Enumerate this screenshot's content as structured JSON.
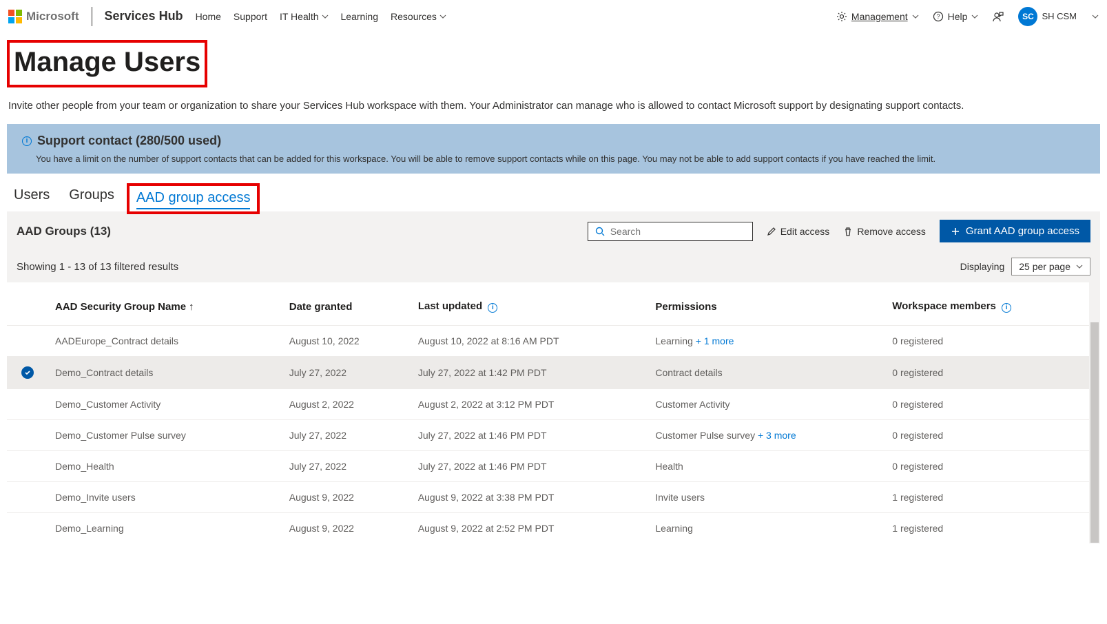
{
  "header": {
    "brand": "Microsoft",
    "hub": "Services Hub",
    "nav": [
      "Home",
      "Support",
      "IT Health",
      "Learning",
      "Resources"
    ],
    "management": "Management",
    "help": "Help",
    "account_initials": "SC",
    "account_name": "SH CSM"
  },
  "page": {
    "title": "Manage Users",
    "subtitle": "Invite other people from your team or organization to share your Services Hub workspace with them. Your Administrator can manage who is allowed to contact Microsoft support by designating support contacts."
  },
  "banner": {
    "title": "Support contact (280/500 used)",
    "message": "You have a limit on the number of support contacts that can be added for this workspace. You will be able to remove support contacts while on this page. You may not be able to add support contacts if you have reached the limit."
  },
  "tabs": {
    "users": "Users",
    "groups": "Groups",
    "aad": "AAD group access"
  },
  "toolbar": {
    "section_label": "AAD Groups (13)",
    "search_placeholder": "Search",
    "edit_access": "Edit access",
    "remove_access": "Remove access",
    "grant": "Grant AAD group access"
  },
  "pager": {
    "showing": "Showing 1 - 13 of 13 filtered results",
    "displaying": "Displaying",
    "per_page": "25 per page"
  },
  "columns": {
    "name": "AAD Security Group Name",
    "date": "Date granted",
    "updated": "Last updated",
    "perms": "Permissions",
    "members": "Workspace members"
  },
  "rows": [
    {
      "name": "AADEurope_Contract details",
      "date": "August 10, 2022",
      "updated": "August 10, 2022 at 8:16 AM PDT",
      "perms": "Learning",
      "more": "+ 1 more",
      "members": "0 registered",
      "selected": false
    },
    {
      "name": "Demo_Contract details",
      "date": "July 27, 2022",
      "updated": "July 27, 2022 at 1:42 PM PDT",
      "perms": "Contract details",
      "more": "",
      "members": "0 registered",
      "selected": true
    },
    {
      "name": "Demo_Customer Activity",
      "date": "August 2, 2022",
      "updated": "August 2, 2022 at 3:12 PM PDT",
      "perms": "Customer Activity",
      "more": "",
      "members": "0 registered",
      "selected": false
    },
    {
      "name": "Demo_Customer Pulse survey",
      "date": "July 27, 2022",
      "updated": "July 27, 2022 at 1:46 PM PDT",
      "perms": "Customer Pulse survey",
      "more": "+ 3 more",
      "members": "0 registered",
      "selected": false
    },
    {
      "name": "Demo_Health",
      "date": "July 27, 2022",
      "updated": "July 27, 2022 at 1:46 PM PDT",
      "perms": "Health",
      "more": "",
      "members": "0 registered",
      "selected": false
    },
    {
      "name": "Demo_Invite users",
      "date": "August 9, 2022",
      "updated": "August 9, 2022 at 3:38 PM PDT",
      "perms": "Invite users",
      "more": "",
      "members": "1 registered",
      "selected": false
    },
    {
      "name": "Demo_Learning",
      "date": "August 9, 2022",
      "updated": "August 9, 2022 at 2:52 PM PDT",
      "perms": "Learning",
      "more": "",
      "members": "1 registered",
      "selected": false
    }
  ]
}
